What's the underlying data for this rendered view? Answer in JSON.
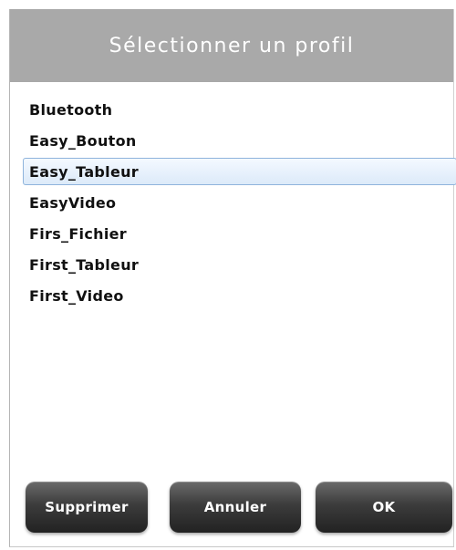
{
  "dialog": {
    "title": "Sélectionner un profil",
    "profiles": [
      {
        "label": "Bluetooth",
        "selected": false
      },
      {
        "label": "Easy_Bouton",
        "selected": false
      },
      {
        "label": "Easy_Tableur",
        "selected": true
      },
      {
        "label": "EasyVideo",
        "selected": false
      },
      {
        "label": "Firs_Fichier",
        "selected": false
      },
      {
        "label": "First_Tableur",
        "selected": false
      },
      {
        "label": "First_Video",
        "selected": false
      }
    ],
    "buttons": {
      "delete_label": "Supprimer",
      "cancel_label": "Annuler",
      "ok_label": "OK"
    }
  },
  "colors": {
    "title_bar": "#a9a9a9",
    "selection_background": "#dceaf9",
    "selection_border": "#8fb4dc",
    "button_dark": "#2a2a2a"
  }
}
